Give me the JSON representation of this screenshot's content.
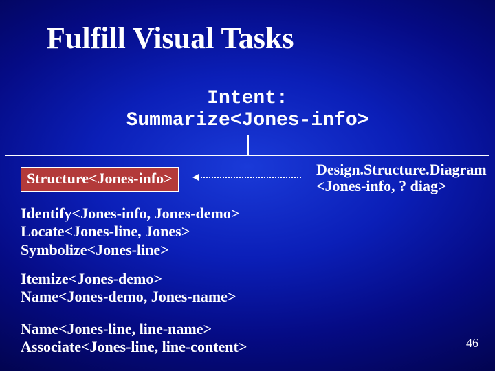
{
  "title": "Fulfill Visual Tasks",
  "intent": {
    "line1": "Intent:",
    "line2": "Summarize<Jones-info>"
  },
  "structure_box": "Structure<Jones-info>",
  "design": {
    "line1": "Design.Structure.Diagram",
    "line2": "<Jones-info, ? diag>"
  },
  "group1": {
    "l1": "Identify<Jones-info, Jones-demo>",
    "l2": "Locate<Jones-line, Jones>",
    "l3": "Symbolize<Jones-line>"
  },
  "group2": {
    "l1": "Itemize<Jones-demo>",
    "l2": "Name<Jones-demo, Jones-name>"
  },
  "group3": {
    "l1": "Name<Jones-line, line-name>",
    "l2": "Associate<Jones-line, line-content>"
  },
  "page_number": "46"
}
